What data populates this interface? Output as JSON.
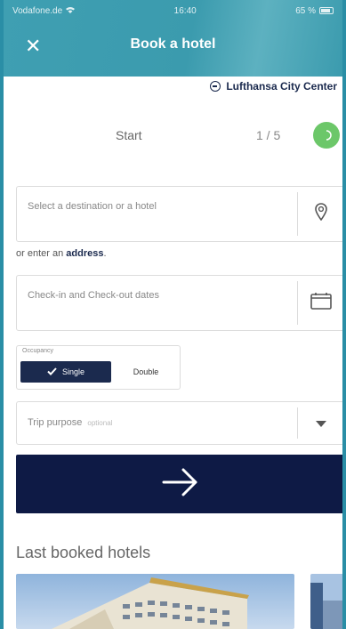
{
  "status_bar": {
    "carrier": "Vodafone.de",
    "time": "16:40",
    "battery": "65 %"
  },
  "header": {
    "title": "Book a hotel",
    "close_icon": "close-icon"
  },
  "brand": {
    "name": "Lufthansa City Center"
  },
  "stepper": {
    "label": "Start",
    "progress": "1 / 5",
    "current_step": 1,
    "total_steps": 5
  },
  "destination": {
    "placeholder": "Select a destination or a hotel",
    "icon": "location-pin-icon"
  },
  "address_hint": {
    "prefix": "or enter an ",
    "link": "address",
    "suffix": "."
  },
  "dates": {
    "placeholder": "Check-in and Check-out dates",
    "icon": "calendar-icon"
  },
  "occupancy": {
    "caption": "Occupancy",
    "options": [
      "Single",
      "Double"
    ],
    "selected": "Single"
  },
  "trip_purpose": {
    "label": "Trip purpose",
    "optional": "optional",
    "icon": "chevron-down-icon"
  },
  "submit": {
    "icon": "arrow-right-icon"
  },
  "last_booked": {
    "title": "Last booked hotels"
  },
  "colors": {
    "header_teal": "#3b9bae",
    "navy": "#0e1a45",
    "step_green": "#6cc769"
  }
}
